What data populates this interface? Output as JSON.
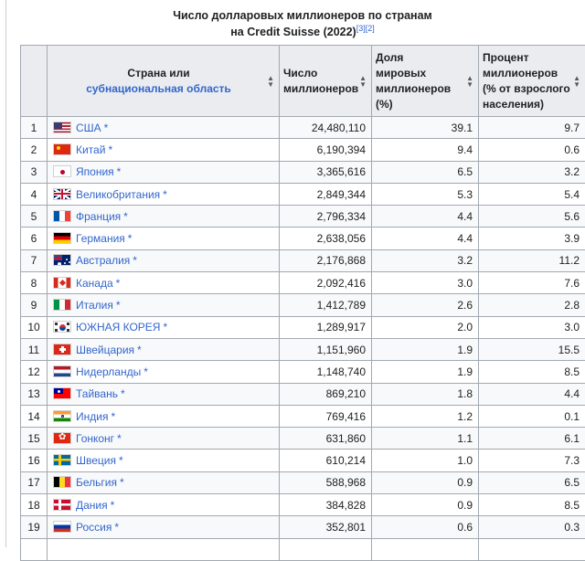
{
  "caption": {
    "line1": "Число долларовых миллионеров по странам",
    "line2": "на Credit Suisse (2022)",
    "refs": "[3][2]"
  },
  "headers": {
    "country_line1": "Страна или",
    "country_line2": "субнациональная область",
    "millionaires_line1": "Число",
    "millionaires_line2": "миллионеров",
    "share_line1": "Доля",
    "share_line2": "мировых",
    "share_line3": "миллионеров (%)",
    "percent_line1": "Процент",
    "percent_line2": "миллионеров",
    "percent_line3": "(% от взрослого",
    "percent_line4": "населения)"
  },
  "sort_icons": {
    "up": "▲",
    "down": "▼"
  },
  "star": "*",
  "rows": [
    {
      "rank": "1",
      "flag": "us",
      "country": "США",
      "millionaires": "24,480,110",
      "share": "39.1",
      "percent": "9.7"
    },
    {
      "rank": "2",
      "flag": "cn",
      "country": "Китай",
      "millionaires": "6,190,394",
      "share": "9.4",
      "percent": "0.6"
    },
    {
      "rank": "3",
      "flag": "jp",
      "country": "Япония",
      "millionaires": "3,365,616",
      "share": "6.5",
      "percent": "3.2"
    },
    {
      "rank": "4",
      "flag": "gb",
      "country": "Великобритания",
      "millionaires": "2,849,344",
      "share": "5.3",
      "percent": "5.4"
    },
    {
      "rank": "5",
      "flag": "fr",
      "country": "Франция",
      "millionaires": "2,796,334",
      "share": "4.4",
      "percent": "5.6"
    },
    {
      "rank": "6",
      "flag": "de",
      "country": "Германия",
      "millionaires": "2,638,056",
      "share": "4.4",
      "percent": "3.9"
    },
    {
      "rank": "7",
      "flag": "au",
      "country": "Австралия",
      "millionaires": "2,176,868",
      "share": "3.2",
      "percent": "11.2"
    },
    {
      "rank": "8",
      "flag": "ca",
      "country": "Канада",
      "millionaires": "2,092,416",
      "share": "3.0",
      "percent": "7.6"
    },
    {
      "rank": "9",
      "flag": "it",
      "country": "Италия",
      "millionaires": "1,412,789",
      "share": "2.6",
      "percent": "2.8"
    },
    {
      "rank": "10",
      "flag": "kr",
      "country": "ЮЖНАЯ КОРЕЯ",
      "millionaires": "1,289,917",
      "share": "2.0",
      "percent": "3.0"
    },
    {
      "rank": "11",
      "flag": "ch",
      "country": "Швейцария",
      "millionaires": "1,151,960",
      "share": "1.9",
      "percent": "15.5"
    },
    {
      "rank": "12",
      "flag": "nl",
      "country": "Нидерланды",
      "millionaires": "1,148,740",
      "share": "1.9",
      "percent": "8.5"
    },
    {
      "rank": "13",
      "flag": "tw",
      "country": "Тайвань",
      "millionaires": "869,210",
      "share": "1.8",
      "percent": "4.4"
    },
    {
      "rank": "14",
      "flag": "in",
      "country": "Индия",
      "millionaires": "769,416",
      "share": "1.2",
      "percent": "0.1"
    },
    {
      "rank": "15",
      "flag": "hk",
      "country": "Гонконг",
      "millionaires": "631,860",
      "share": "1.1",
      "percent": "6.1"
    },
    {
      "rank": "16",
      "flag": "se",
      "country": "Швеция",
      "millionaires": "610,214",
      "share": "1.0",
      "percent": "7.3"
    },
    {
      "rank": "17",
      "flag": "be",
      "country": "Бельгия",
      "millionaires": "588,968",
      "share": "0.9",
      "percent": "6.5"
    },
    {
      "rank": "18",
      "flag": "dk",
      "country": "Дания",
      "millionaires": "384,828",
      "share": "0.9",
      "percent": "8.5"
    },
    {
      "rank": "19",
      "flag": "ru",
      "country": "Россия",
      "millionaires": "352,801",
      "share": "0.6",
      "percent": "0.3"
    }
  ]
}
